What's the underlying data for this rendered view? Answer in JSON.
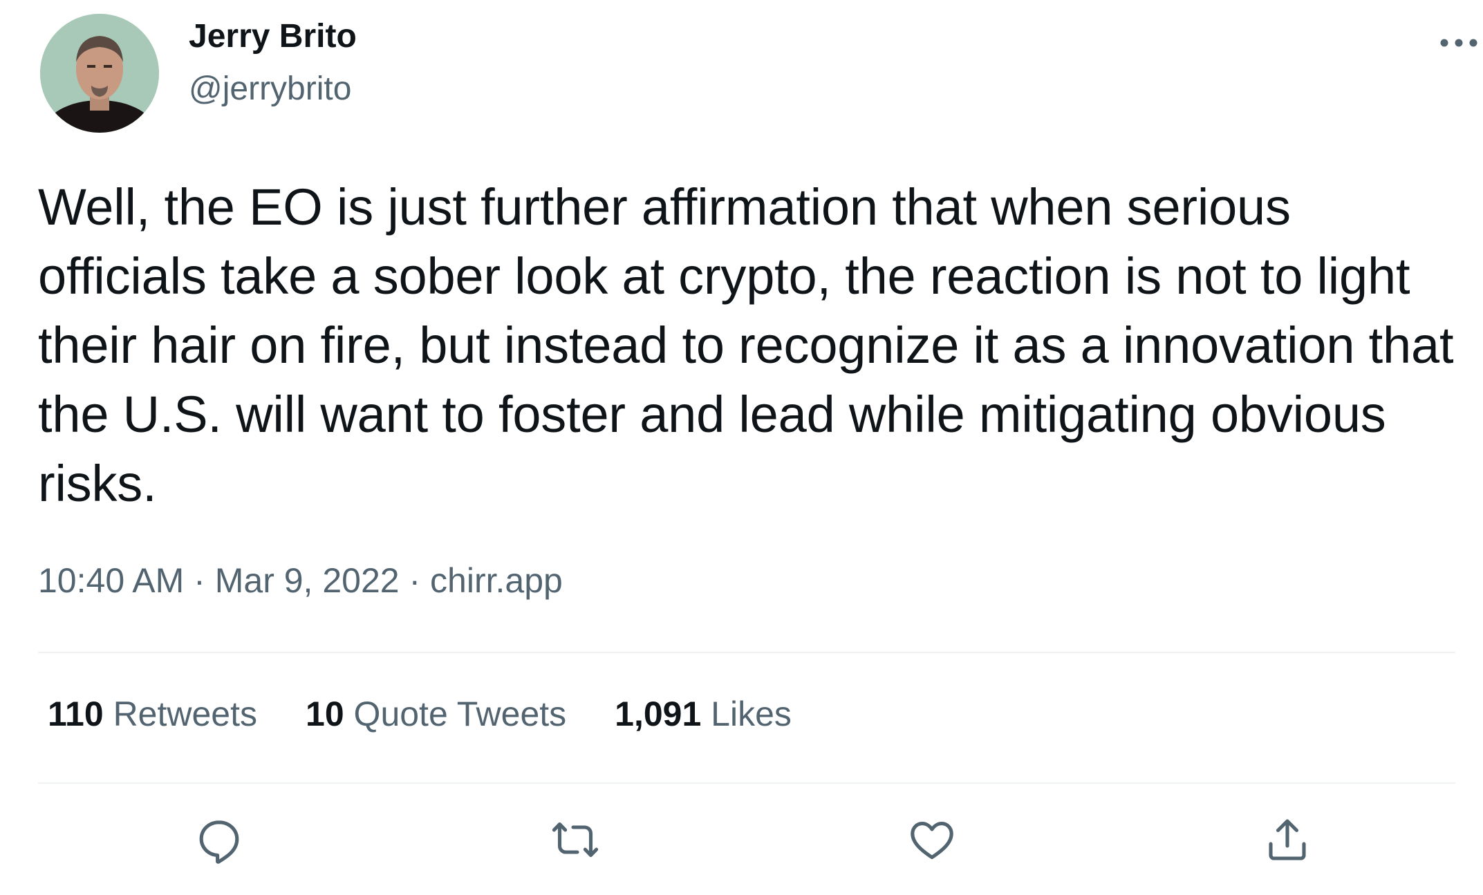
{
  "author": {
    "display_name": "Jerry Brito",
    "handle": "@jerrybrito",
    "avatar_icon": "user-avatar"
  },
  "tweet": {
    "text": "Well, the EO is just further affirmation that when serious officials take a sober look at crypto, the reaction is not to light their hair on fire, but instead to recognize it as a innovation that the U.S. will want to foster and lead while mitigating obvious risks.",
    "time": "10:40 AM",
    "separator": "·",
    "date": "Mar 9, 2022",
    "source": "chirr.app"
  },
  "stats": {
    "retweets_count": "110",
    "retweets_label": "Retweets",
    "quotes_count": "10",
    "quotes_label": "Quote Tweets",
    "likes_count": "1,091",
    "likes_label": "Likes"
  },
  "actions": [
    {
      "icon": "reply-icon"
    },
    {
      "icon": "retweet-icon"
    },
    {
      "icon": "like-icon"
    },
    {
      "icon": "share-icon"
    }
  ],
  "colors": {
    "text_primary": "#0f1419",
    "text_secondary": "#536471",
    "divider": "#eff3f4"
  }
}
